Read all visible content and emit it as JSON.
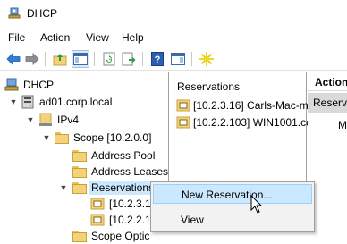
{
  "window": {
    "title": "DHCP"
  },
  "menu": [
    "File",
    "Action",
    "View",
    "Help"
  ],
  "toolbar": {
    "icons": [
      "back-arrow-icon",
      "forward-arrow-icon",
      "up-folder-icon",
      "show-hide-tree-icon",
      "refresh-icon",
      "export-list-icon",
      "help-icon",
      "properties-icon",
      "new-star-icon"
    ]
  },
  "tree": {
    "root": "DHCP",
    "server": "ad01.corp.local",
    "ipv4": "IPv4",
    "scope": "Scope [10.2.0.0]",
    "address_pool": "Address Pool",
    "address_leases": "Address Leases",
    "reservations": "Reservations",
    "res1": "[10.2.3.1",
    "res2": "[10.2.2.1",
    "scope_options": "Scope Optic"
  },
  "center": {
    "header": "Reservations",
    "items": [
      "[10.2.3.16] Carls-Mac-m",
      "[10.2.2.103] WIN1001.con"
    ]
  },
  "actions": {
    "header": "Action",
    "selected": "Reserv",
    "more": "M"
  },
  "context_menu": {
    "new_reservation": "New Reservation...",
    "view": "View"
  },
  "colors": {
    "selection": "#cce8ff",
    "folder": "#f3d27a"
  }
}
